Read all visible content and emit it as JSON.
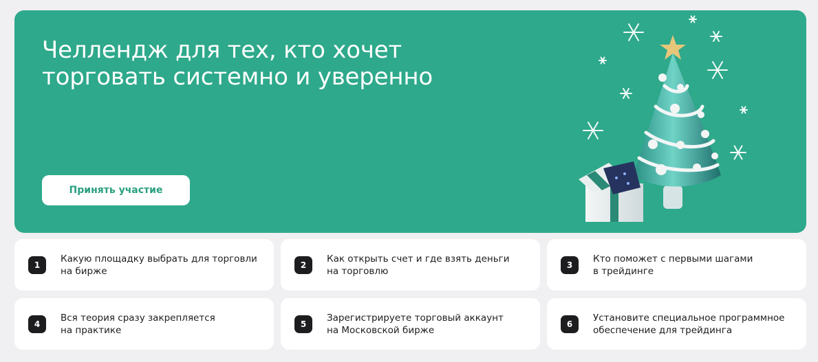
{
  "hero": {
    "title_line1": "Челлендж для тех, кто хочет",
    "title_line2": "торговать системно и уверенно",
    "cta_label": "Принять участие",
    "illustration": "christmas-tree-with-gift-and-snowflakes",
    "colors": {
      "background": "#2ea98b",
      "cta_text": "#2a9f80"
    }
  },
  "steps": [
    {
      "number": "1",
      "line1": "Какую площадку выбрать для торговли",
      "line2": "на бирже"
    },
    {
      "number": "2",
      "line1": "Как открыть счет и где взять деньги",
      "line2": "на торговлю"
    },
    {
      "number": "3",
      "line1": "Кто поможет с первыми шагами",
      "line2": "в трейдинге"
    },
    {
      "number": "4",
      "line1": "Вся теория сразу закрепляется",
      "line2": "на практике"
    },
    {
      "number": "5",
      "line1": "Зарегистрируете торговый аккаунт",
      "line2": "на Московской бирже"
    },
    {
      "number": "6",
      "line1": "Установите специальное программное",
      "line2": "обеспечение для трейдинга"
    }
  ]
}
